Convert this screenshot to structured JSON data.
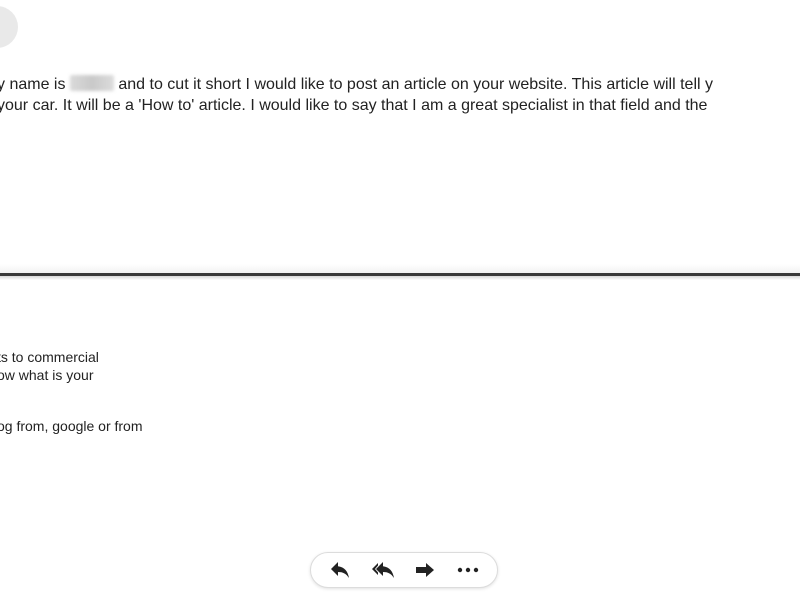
{
  "message_top": {
    "line1_before": "y name is",
    "line1_after": " and to cut it short I would like to post an article on your website. This article will tell y",
    "line2": "your car. It will be a 'How to' article. I would like to say that I am a great specialist in that field and the"
  },
  "message_bottom": {
    "lines": [
      "ts to commercial",
      "ow what is your",
      "og from, google or from"
    ]
  },
  "action_bar": {
    "buttons": [
      {
        "name": "reply",
        "icon": "reply-icon"
      },
      {
        "name": "reply-all",
        "icon": "reply-all-icon"
      },
      {
        "name": "forward",
        "icon": "forward-icon"
      },
      {
        "name": "more",
        "icon": "more-icon"
      }
    ],
    "icon_color": "#222222"
  }
}
